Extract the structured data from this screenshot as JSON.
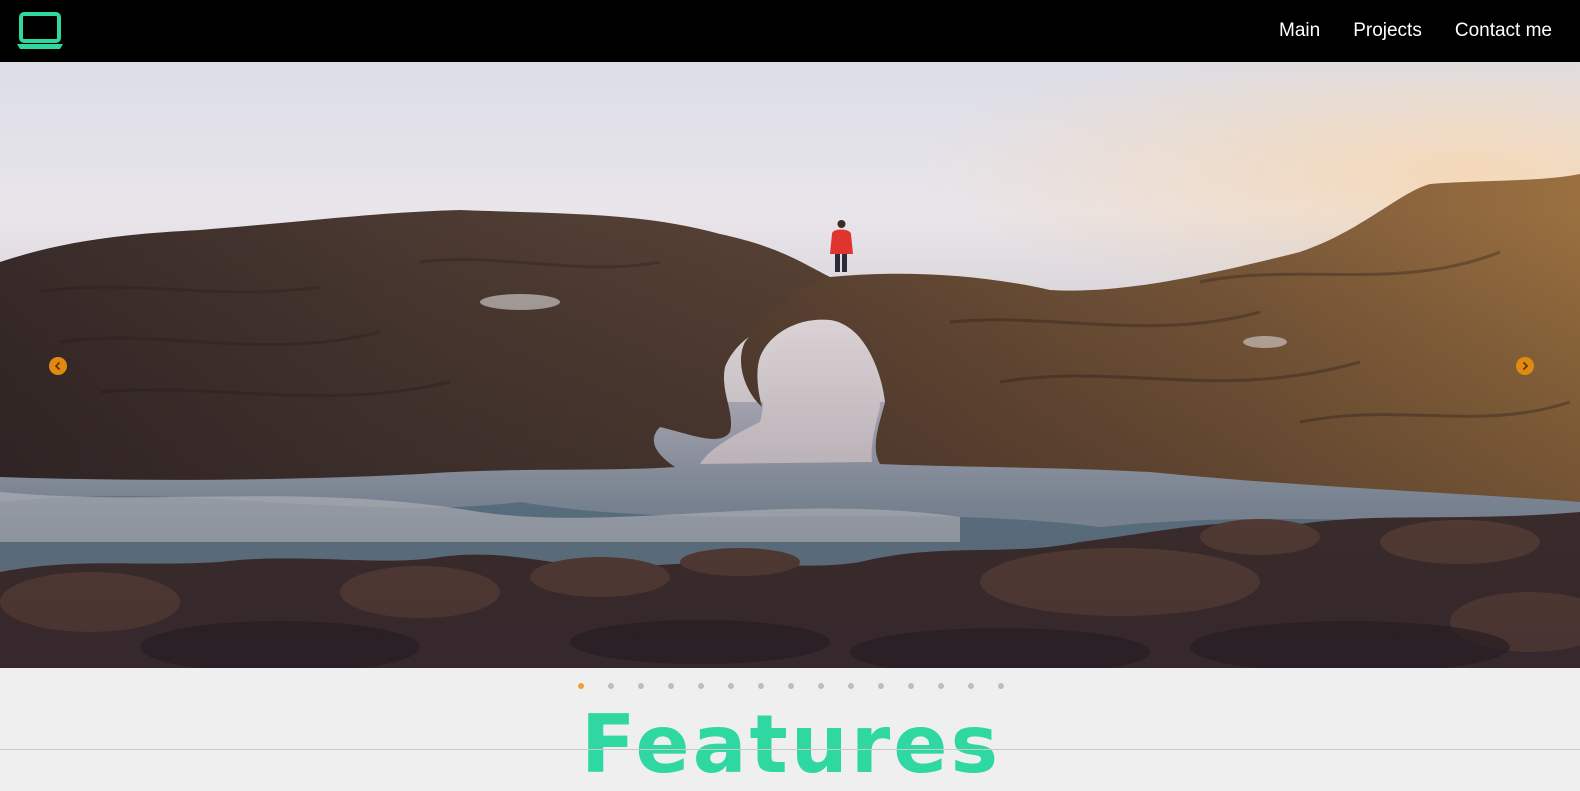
{
  "navbar": {
    "logo_icon": "laptop-icon",
    "accent_color": "#2ed8a0",
    "links": [
      {
        "label": "Main"
      },
      {
        "label": "Projects"
      },
      {
        "label": "Contact me"
      }
    ]
  },
  "carousel": {
    "slide_image": "sea-rock-arch-with-person-photo",
    "prev_icon": "chevron-left-icon",
    "next_icon": "chevron-right-icon",
    "arrow_color": "#e08a12",
    "slide_count": 15,
    "active_slide": 1,
    "active_dot_color": "#f0a030"
  },
  "features": {
    "title": "Features"
  }
}
